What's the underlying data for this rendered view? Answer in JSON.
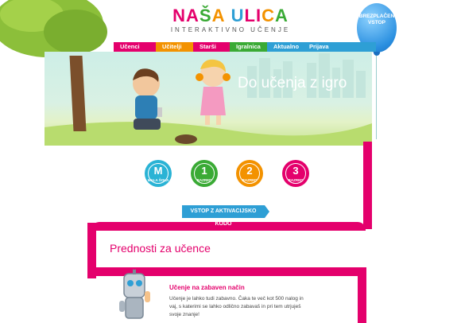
{
  "logo": {
    "title": "NAŠA ULICA",
    "subtitle": "INTERAKTIVNO UČENJE"
  },
  "balloon": {
    "line1": "BREZPLAČEN",
    "line2": "VSTOP"
  },
  "nav": {
    "items": [
      {
        "label": "Učenci",
        "color": "#e4006c"
      },
      {
        "label": "Učitelji",
        "color": "#f39200"
      },
      {
        "label": "Starši",
        "color": "#e4006c"
      },
      {
        "label": "Igralnica",
        "color": "#3aaa35"
      },
      {
        "label": "Aktualno",
        "color": "#2e9fd5"
      },
      {
        "label": "Prijava",
        "color": "#2e9fd5"
      }
    ]
  },
  "hero": {
    "title": "Do učenja z igro"
  },
  "grades": [
    {
      "num": "M",
      "sub": "MALA ŠOLA",
      "color": "#2ab3d5"
    },
    {
      "num": "1",
      "sub": "RAZRED",
      "color": "#3aaa35"
    },
    {
      "num": "2",
      "sub": "RAZRED",
      "color": "#f39200"
    },
    {
      "num": "3",
      "sub": "RAZRED",
      "color": "#e4006c"
    }
  ],
  "cta": {
    "label": "VSTOP Z AKTIVACIJSKO KODO"
  },
  "advantages": {
    "title": "Prednosti za učence",
    "feature_title": "Učenje na zabaven način",
    "feature_text": "Učenje je lahko tudi zabavno. Čaka te več kot 500 nalog in vaj, s katerimi se lahko odlično zabavaš in pri tem utrjuješ svoje znanje!"
  },
  "colors": {
    "pink": "#e4006c",
    "orange": "#f39200",
    "green": "#3aaa35",
    "blue": "#2e9fd5"
  }
}
